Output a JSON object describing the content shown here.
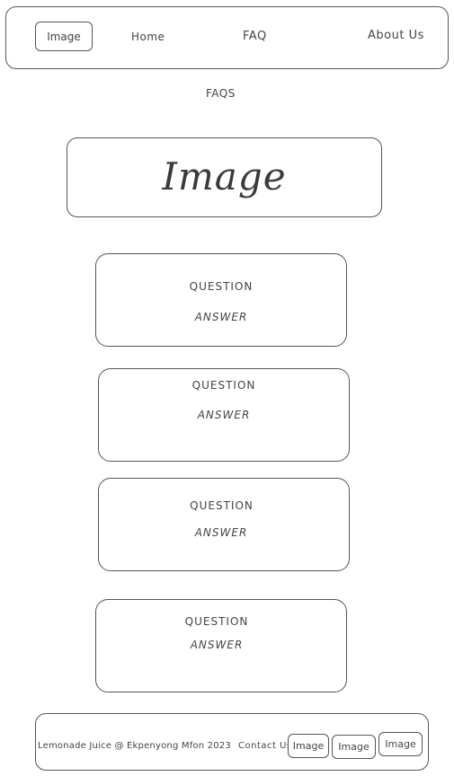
{
  "header": {
    "logo_label": "Image",
    "nav": {
      "home": "Home",
      "faq": "FAQ",
      "about": "About Us"
    }
  },
  "page_heading": "FAQS",
  "hero": {
    "label": "Image"
  },
  "faqs": [
    {
      "question": "QUESTION",
      "answer": "ANSWER"
    },
    {
      "question": "QUESTION",
      "answer": "ANSWER"
    },
    {
      "question": "QUESTION",
      "answer": "ANSWER"
    },
    {
      "question": "QUESTION",
      "answer": "ANSWER"
    }
  ],
  "footer": {
    "text": "Lemonade Juice @ Ekpenyong Mfon 2023",
    "contact": "Contact Us",
    "images": [
      "Image",
      "Image",
      "Image"
    ]
  }
}
